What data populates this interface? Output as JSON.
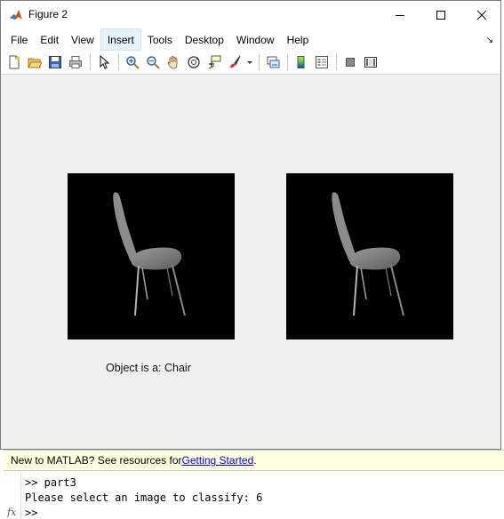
{
  "window": {
    "title": "Figure 2"
  },
  "menu": [
    "File",
    "Edit",
    "View",
    "Insert",
    "Tools",
    "Desktop",
    "Window",
    "Help"
  ],
  "active_menu_index": 3,
  "toolbar_icons": [
    "new-figure-icon",
    "open-file-icon",
    "save-icon",
    "print-icon",
    "edit-plot-arrow-icon",
    "zoom-in-icon",
    "zoom-out-icon",
    "pan-hand-icon",
    "rotate-3d-icon",
    "data-cursor-icon",
    "brush-icon",
    "brush-dropdown-icon",
    "link-plot-icon",
    "colorbar-icon",
    "legend-icon",
    "hide-plot-tools-icon",
    "show-plot-tools-icon"
  ],
  "figure": {
    "caption": "Object is a: Chair"
  },
  "command_window": {
    "banner_prefix": "New to MATLAB? See resources for ",
    "banner_link": "Getting Started",
    "banner_suffix": ".",
    "lines": [
      ">> part3",
      "Please select an image to classify: 6",
      ">>"
    ],
    "fx_label": "fx"
  }
}
